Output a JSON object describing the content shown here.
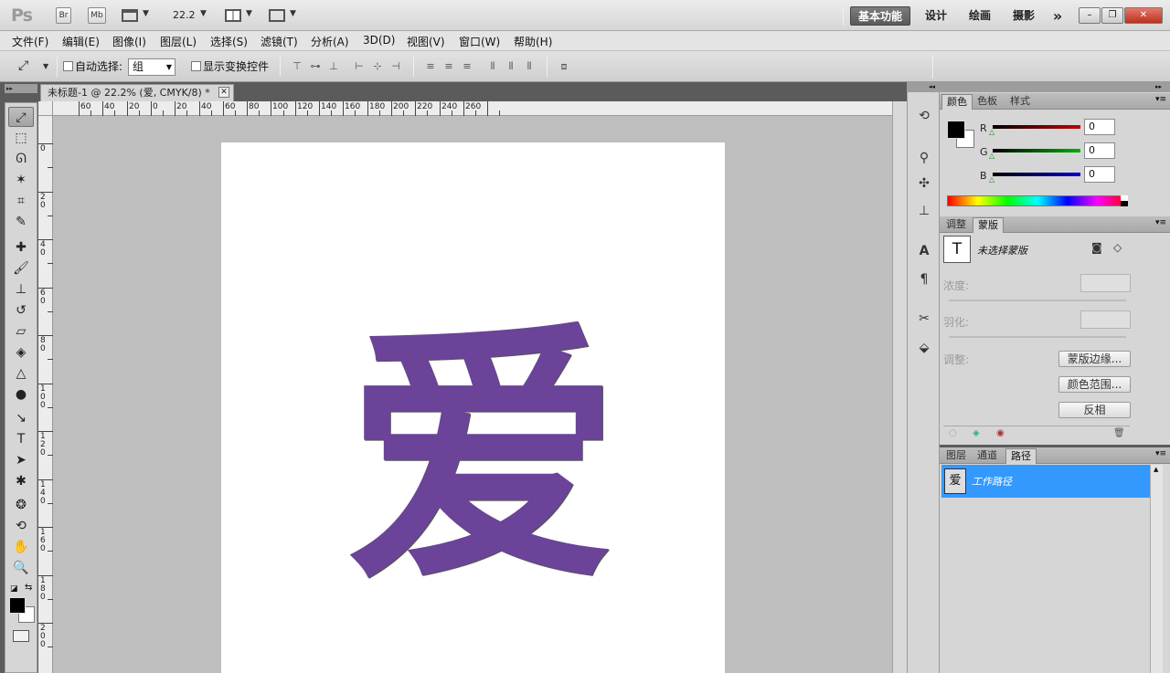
{
  "app": {
    "logo": "Ps",
    "bridge": "Br",
    "minibridge": "Mb",
    "zoom_value": "22.2"
  },
  "workspaces": [
    "基本功能",
    "设计",
    "绘画",
    "摄影"
  ],
  "workspace_more": "»",
  "window_controls": {
    "minimize": "–",
    "restore": "❐",
    "close": "✕"
  },
  "menu": [
    "文件(F)",
    "编辑(E)",
    "图像(I)",
    "图层(L)",
    "选择(S)",
    "滤镜(T)",
    "分析(A)",
    "3D(D)",
    "视图(V)",
    "窗口(W)",
    "帮助(H)"
  ],
  "options": {
    "auto_select_label": "自动选择:",
    "auto_select_value": "组",
    "show_transform_label": "显示变换控件"
  },
  "document": {
    "tab_title": "未标题-1 @ 22.2% (爱, CMYK/8) *",
    "glyph": "爱",
    "glyph_color": "#6b4399"
  },
  "ruler": {
    "h_labels": [
      "60",
      "40",
      "20",
      "0",
      "20",
      "40",
      "60",
      "80",
      "100",
      "120",
      "140",
      "160",
      "180",
      "200",
      "220",
      "240",
      "260"
    ],
    "v_labels": [
      "0",
      "20",
      "40",
      "60",
      "80",
      "100",
      "120",
      "140",
      "160",
      "180",
      "200"
    ]
  },
  "color_panel": {
    "tabs": [
      "颜色",
      "色板",
      "样式"
    ],
    "channels": [
      {
        "label": "R",
        "value": "0",
        "color": "#c00000"
      },
      {
        "label": "G",
        "value": "0",
        "color": "#00b000"
      },
      {
        "label": "B",
        "value": "0",
        "color": "#0000c8"
      }
    ]
  },
  "masks_panel": {
    "tabs": [
      "调整",
      "蒙版"
    ],
    "status": "未选择蒙版",
    "density_label": "浓度:",
    "feather_label": "羽化:",
    "refine_label": "调整:",
    "buttons": [
      "蒙版边缘...",
      "颜色范围...",
      "反相"
    ]
  },
  "layers_panel": {
    "tabs": [
      "图层",
      "通道",
      "路径"
    ],
    "paths": [
      {
        "name": "工作路径"
      }
    ]
  },
  "colors": {
    "accent": "#3399ff",
    "toolbar_bg": "#d6d6d6",
    "canvas_bg": "#bebebe"
  }
}
